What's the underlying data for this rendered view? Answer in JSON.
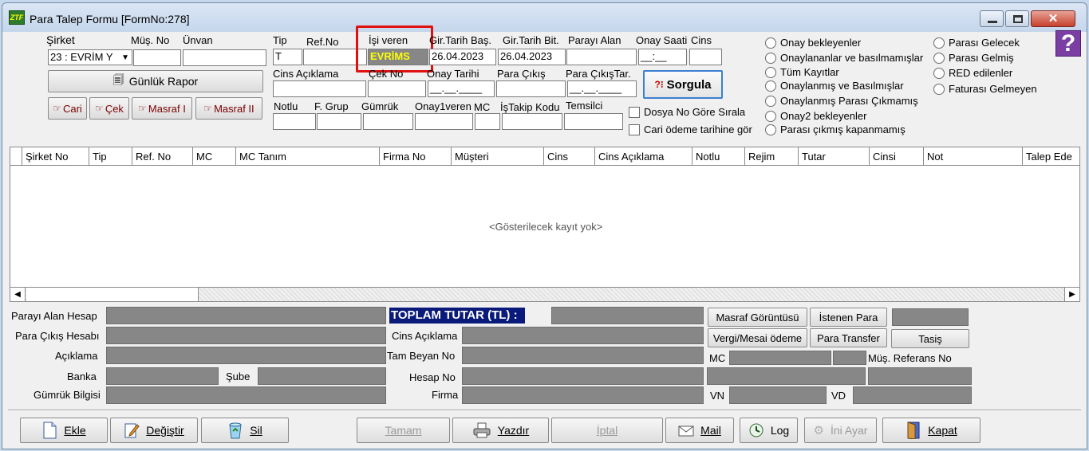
{
  "window": {
    "title": "Para Talep Formu [FormNo:278]"
  },
  "filters": {
    "sirket_label": "Şirket",
    "sirket_value": "23 : EVRİM Y",
    "mus_no_label": "Müş. No",
    "unvan_label": "Ünvan",
    "tip_label": "Tip",
    "tip_value": "T",
    "ref_no_label": "Ref.No",
    "isi_veren_label": "İşi veren",
    "isi_veren_value": "EVRİMS",
    "gir_tarih_bas_label": "Gir.Tarih Baş.",
    "gir_tarih_bas_value": "26.04.2023",
    "gir_tarih_bit_label": "Gir.Tarih Bit.",
    "gir_tarih_bit_value": "26.04.2023",
    "parayi_alan_label": "Parayı Alan",
    "onay_saati_label": "Onay Saati",
    "onay_saati_value": "__:__",
    "cins_label": "Cins",
    "cins_aciklama_label": "Cins Açıklama",
    "cek_no_label": "Çek No",
    "onay_tarihi_label": "Onay Tarihi",
    "onay_tarihi_value": "__.__.____",
    "para_cikis_label": "Para Çıkış",
    "para_cikis_tar_label": "Para ÇıkışTar.",
    "para_cikis_tar_value": "__.__.____",
    "notlu_label": "Notlu",
    "f_grup_label": "F. Grup",
    "gumruk_label": "Gümrük",
    "onay1veren_label": "Onay1veren",
    "mc_label": "MC",
    "istakip_label": "İşTakip Kodu",
    "temsilci_label": "Temsilci",
    "gunluk_rapor": "Günlük Rapor",
    "cari": "Cari",
    "cek": "Çek",
    "masraf1": "Masraf I",
    "masraf2": "Masraf II",
    "sorgula": "Sorgula",
    "dosya_no_sirala": "Dosya No Göre Sırala",
    "cari_odeme": "Cari ödeme tarihine gör"
  },
  "radios_left": [
    "Onay bekleyenler",
    "Onaylananlar ve basılmamışlar",
    "Tüm Kayıtlar",
    "Onaylanmış ve Basılmışlar",
    "Onaylanmış Parası Çıkmamış",
    "Onay2 bekleyenler",
    "Parası çıkmış kapanmamış"
  ],
  "radios_right": [
    "Parası Gelecek",
    "Parası Gelmiş",
    "RED edilenler",
    "Faturası Gelmeyen"
  ],
  "grid": {
    "columns": [
      "Şirket No",
      "Tip",
      "Ref. No",
      "MC",
      "MC Tanım",
      "Firma No",
      "Müşteri",
      "Cins",
      "Cins Açıklama",
      "Notlu",
      "Rejim",
      "Tutar",
      "Cinsi",
      "Not",
      "Talep Ede"
    ],
    "empty_text": "<Gösterilecek kayıt yok>"
  },
  "details": {
    "parayi_alan_hesap": "Parayı Alan Hesap",
    "para_cikis_hesabi": "Para Çıkış Hesabı",
    "aciklama": "Açıklama",
    "banka": "Banka",
    "sube": "Şube",
    "gumruk_bilgisi": "Gümrük Bilgisi",
    "toplam_tutar": "TOPLAM TUTAR (TL) :",
    "cins_aciklama": "Cins Açıklama",
    "tam_beyan_no": "Tam Beyan No",
    "hesap_no": "Hesap No",
    "firma": "Firma",
    "masraf_goruntusu": "Masraf Görüntüsü",
    "istenen_para": "İstenen Para",
    "vergi_mesai": "Vergi/Mesai ödeme",
    "para_transfer": "Para Transfer",
    "tasis": "Tasiş",
    "mc": "MC",
    "mus_referans_no": "Müş. Referans No",
    "vn": "VN",
    "vd": "VD"
  },
  "footer": {
    "ekle": "Ekle",
    "degistir": "Değiştir",
    "sil": "Sil",
    "tamam": "Tamam",
    "yazdir": "Yazdır",
    "iptal": "İptal",
    "mail": "Mail",
    "log": "Log",
    "ini_ayar": "İni Ayar",
    "kapat": "Kapat"
  },
  "colors": {
    "highlight": "#e01010",
    "total_bg": "#0a1a7a",
    "isi_veren_text": "#ffff00"
  }
}
